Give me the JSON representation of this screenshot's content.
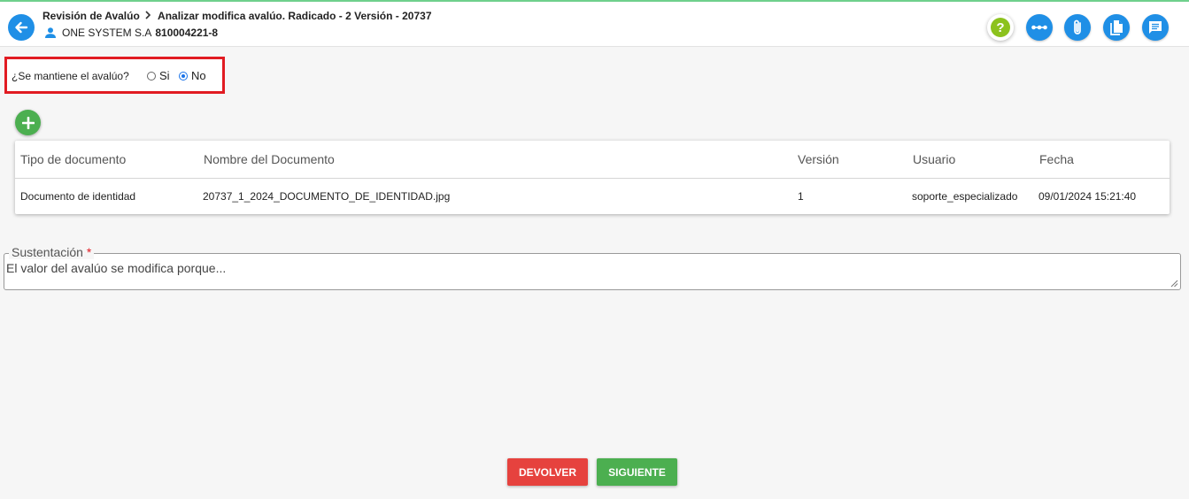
{
  "header": {
    "breadcrumb_parent": "Revisión de Avalúo",
    "breadcrumb_current": "Analizar modifica avalúo. Radicado - 2 Versión - 20737",
    "company_name": "ONE SYSTEM S.A",
    "company_nit": "810004221-8",
    "help_symbol": "?",
    "icons": [
      "back-arrow-icon",
      "user-icon",
      "help-icon",
      "more-icon",
      "attachment-icon",
      "document-copy-icon",
      "comment-icon"
    ]
  },
  "question": {
    "label": "¿Se mantiene el avalúo?",
    "options": [
      {
        "label": "Si",
        "checked": false
      },
      {
        "label": "No",
        "checked": true
      }
    ]
  },
  "documents_table": {
    "columns": [
      "Tipo de documento",
      "Nombre del Documento",
      "Versión",
      "Usuario",
      "Fecha"
    ],
    "rows": [
      [
        "Documento de identidad",
        "20737_1_2024_DOCUMENTO_DE_IDENTIDAD.jpg",
        "1",
        "soporte_especializado",
        "09/01/2024 15:21:40"
      ]
    ]
  },
  "sustentacion": {
    "label": "Sustentación",
    "required_mark": "*",
    "value": "El valor del avalúo se modifica porque..."
  },
  "actions": {
    "return_label": "DEVOLVER",
    "next_label": "SIGUIENTE"
  },
  "colors": {
    "primary_blue": "#1f8fe6",
    "help_green": "#8cc21d",
    "add_green": "#4caf50",
    "highlight_red": "#e11b22",
    "return_red": "#e6423e"
  }
}
